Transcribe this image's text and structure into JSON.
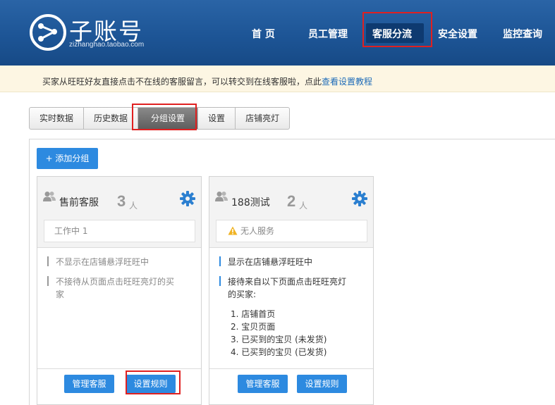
{
  "header": {
    "logo_title": "子账号",
    "logo_subtitle": "zizhanghao.taobao.com",
    "nav": [
      {
        "label": "首 页"
      },
      {
        "label": "员工管理"
      },
      {
        "label": "客服分流",
        "active": true
      },
      {
        "label": "安全设置"
      },
      {
        "label": "监控查询"
      }
    ]
  },
  "notice": {
    "text": "买家从旺旺好友直接点击不在线的客服留言，可以转交到在线客服啦，点此",
    "link": "查看设置教程"
  },
  "tabs": [
    {
      "label": "实时数据"
    },
    {
      "label": "历史数据"
    },
    {
      "label": "分组设置",
      "active": true
    },
    {
      "label": "设置"
    },
    {
      "label": "店铺亮灯"
    }
  ],
  "add_group_label": "+ 添加分组",
  "groups": [
    {
      "name": "售前客服",
      "count": "3",
      "unit": "人",
      "status": "工作中  1",
      "rules": [
        "不显示在店铺悬浮旺旺中",
        "不接待从页面点击旺旺亮灯的买",
        "家"
      ],
      "manage_label": "管理客服",
      "rules_label": "设置规则"
    },
    {
      "name": "188测试",
      "count": "2",
      "unit": "人",
      "status": "无人服务",
      "rules": [
        "显示在店铺悬浮旺旺中",
        "接待来自以下页面点击旺旺亮灯",
        "的买家:"
      ],
      "pages": [
        "1. 店铺首页",
        "2. 宝贝页面",
        "3. 已买到的宝贝 (未发货)",
        "4. 已买到的宝贝 (已发货)"
      ],
      "manage_label": "管理客服",
      "rules_label": "设置规则"
    }
  ],
  "colors": {
    "header": "#1d5596",
    "accent": "#2d8ae0",
    "highlight": "#e02020",
    "notice_bg": "#fdf6e3"
  }
}
